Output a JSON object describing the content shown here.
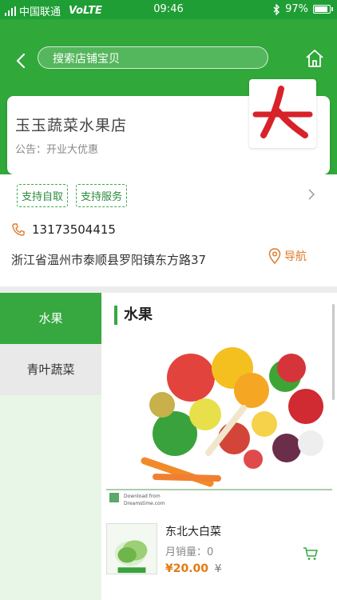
{
  "status_bar": {
    "carrier": "中国联通",
    "network": "VoLTE",
    "time": "09:46",
    "battery": "97%",
    "battery_level": 0.97
  },
  "header": {
    "search_placeholder": "搜索店铺宝贝"
  },
  "shop": {
    "name": "玉玉蔬菜水果店",
    "notice": "公告：开业大优惠",
    "tags": [
      "支持自取",
      "支持服务"
    ],
    "phone": "13173504415",
    "address": "浙江省温州市泰顺县罗阳镇东方路37",
    "nav_label": "导航"
  },
  "sidebar": {
    "items": [
      {
        "label": "水果",
        "active": true
      },
      {
        "label": "青叶蔬菜",
        "active": false
      }
    ]
  },
  "content": {
    "category_title": "水果",
    "banner_caption_lines": [
      "Download from",
      "Dreamstime.com"
    ],
    "product": {
      "name": "东北大白菜",
      "sales": "月销量：0",
      "price": "¥20.00",
      "old_price": "¥"
    }
  },
  "colors": {
    "brand_green": "#30a83a",
    "accent_orange": "#e07a2a"
  }
}
